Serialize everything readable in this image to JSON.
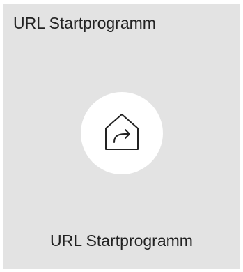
{
  "tile": {
    "title": "URL Startprogramm",
    "label": "URL Startprogramm",
    "icon": "home-launch-icon",
    "background_color": "#e3e3e3",
    "icon_circle_color": "#ffffff"
  }
}
